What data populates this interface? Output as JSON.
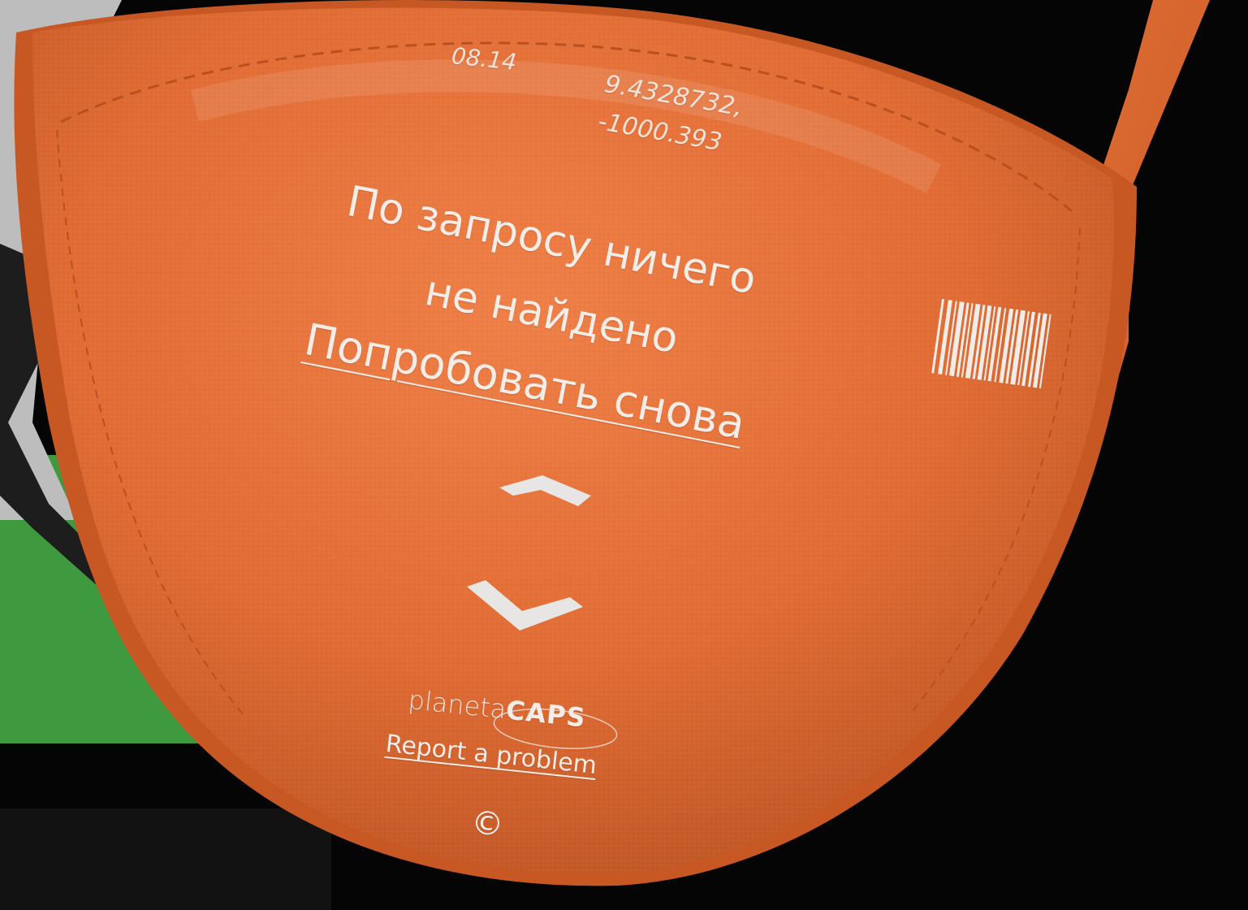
{
  "header": {
    "date": "08.14",
    "coordinates": [
      "9.4328732,",
      "-1000.393"
    ]
  },
  "message": {
    "line1": "По запросу ничего",
    "line2": "не найдено",
    "retry_label": "Попробовать снова"
  },
  "nav": {
    "up_icon": "chevron-up-icon",
    "down_icon": "chevron-down-icon"
  },
  "footer": {
    "brand_light": "planeta",
    "brand_bold": "CAPS",
    "report_label": "Report a problem",
    "copyright": "©"
  },
  "colors": {
    "mask": "#e36d35",
    "mask_shadow": "#b84d1c",
    "background": "#050505",
    "green_panel": "#3f9a3f",
    "text": "#f4ece6"
  }
}
